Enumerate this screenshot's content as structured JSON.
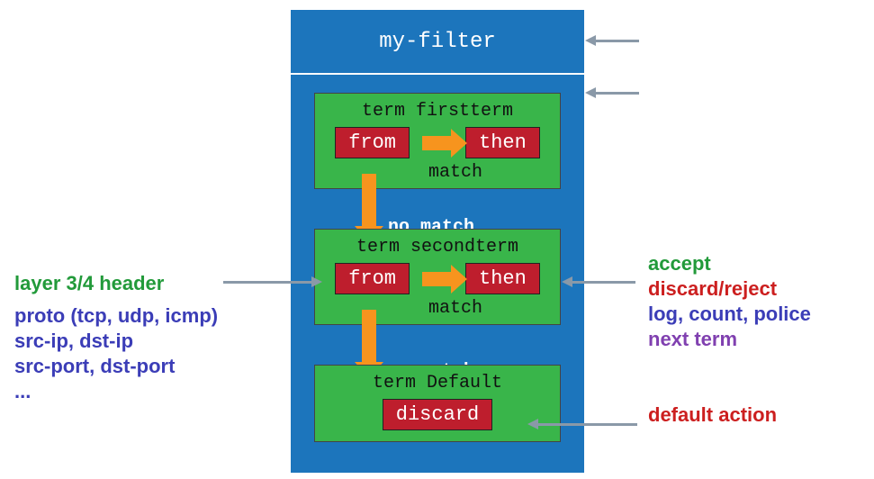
{
  "filter": {
    "title": "my-filter",
    "terms": [
      {
        "name": "term firstterm",
        "from": "from",
        "then": "then",
        "match": "match",
        "no_match": "no match"
      },
      {
        "name": "term secondterm",
        "from": "from",
        "then": "then",
        "match": "match",
        "no_match": "no match"
      }
    ],
    "default_term": {
      "name": "term Default",
      "action": "discard"
    }
  },
  "left": {
    "header": "layer 3/4 header",
    "lines": [
      "proto (tcp, udp, icmp)",
      "src-ip, dst-ip",
      "src-port, dst-port",
      "..."
    ]
  },
  "right": {
    "accept": "accept",
    "discard_reject": "discard/reject",
    "log_count_police": "log, count, police",
    "next_term": "next term",
    "default_action": "default action"
  }
}
